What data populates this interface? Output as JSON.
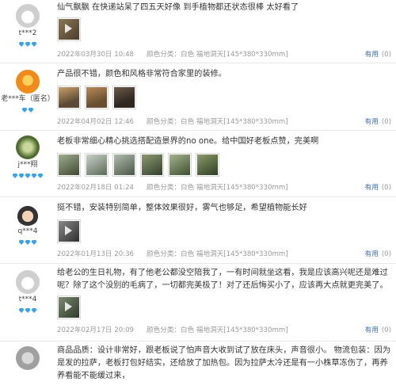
{
  "reviews": [
    {
      "user": "t***2",
      "avatar_colors": [
        "#cfcfcf",
        "#ffffff"
      ],
      "diamonds": 3,
      "text": "仙气飘飘 在快递站呆了四五天好像 到手植物都还状态很棒 太好看了",
      "pics": [
        "#6b5a3e"
      ],
      "date": "2022年03月30日 10:48",
      "color_label": "颜色分类：白色 福地洞天[145*380*330mm]",
      "useful_label": "有用",
      "useful_count": "(0)"
    },
    {
      "user": "老***车（匿名）",
      "avatar_colors": [
        "#f08a1a",
        "#ffd15a"
      ],
      "diamonds": 2,
      "text": "产品很不错，颜色和风格非常符合家里的装修。",
      "pics": [
        "#7a5d3b",
        "#8a6b48",
        "#5c4a36"
      ],
      "date": "2022年04月02日 12:46",
      "color_label": "颜色分类：白色 福地洞天[145*380*330mm]",
      "useful_label": "有用",
      "useful_count": "(0)"
    },
    {
      "user": "j***翔",
      "avatar_colors": [
        "#4d6b2e",
        "#c9d89a"
      ],
      "diamonds": 5,
      "text": "老板非常细心精心挑选搭配造景界的no one。给中国好老板点赞，完美啊",
      "pics": [
        "#5f6e4f",
        "#8a9a8a",
        "#6d7d6a",
        "#4f5a3e",
        "#6a7b5c",
        "#4a5e3a"
      ],
      "date": "2022年02月18日 01:24",
      "color_label": "颜色分类：白色 福地洞天[145*380*330mm]",
      "useful_label": "有用",
      "useful_count": "(0)"
    },
    {
      "user": "q***4",
      "avatar_colors": [
        "#333333",
        "#f2d3b8"
      ],
      "diamonds": 3,
      "text": "挺不错，安装特别简单，整体效果很好，雾气也够足，希望植物能长好",
      "pics": [
        "#5a5a5a"
      ],
      "date": "2022年01月13日 20:36",
      "color_label": "颜色分类：白色 福地洞天[145*380*330mm]",
      "useful_label": "有用",
      "useful_count": "(0)"
    },
    {
      "user": "t***4",
      "avatar_colors": [
        "#cfcfcf",
        "#ffffff"
      ],
      "diamonds": 3,
      "text": "给老公的生日礼物，有了他老公都没空陪我了，一有时间就坐这看，我是应该高兴呢还是难过呢？除了这个没别的毛病了，一切都完美极了！对了还后悔买小了，应该再大点就更完美了。",
      "pics": [
        "#4e5a46"
      ],
      "date": "2022年02月17日 20:09",
      "color_label": "颜色分类：白色 福地洞天[145*380*330mm]",
      "useful_label": "有用",
      "useful_count": "(0)"
    },
    {
      "user": "",
      "avatar_colors": [
        "#a0a0a0",
        "#d8d8d8"
      ],
      "diamonds": 0,
      "text": "商品品质：设计非常好，跟老板说了怕声音大收到试了放在床头，声音很小。 物流包装：因为是发的拉萨，老板打包好结实，还给放了加热包。因为拉萨太冷还是有一小株草冻伤了，再养养看能不能缓过来，",
      "pics": [],
      "date": "",
      "color_label": "",
      "useful_label": "",
      "useful_count": ""
    }
  ],
  "diamond_color": "#3ba3e8"
}
